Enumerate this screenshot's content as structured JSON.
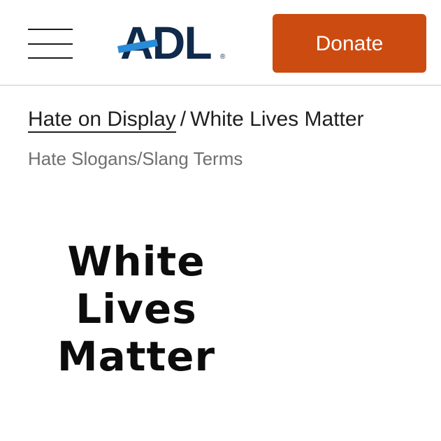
{
  "header": {
    "menu_icon": "hamburger-menu-icon",
    "logo": {
      "text": "ADL",
      "registered": "®",
      "colors": {
        "letters": "#0f2a4a",
        "stripe": "#2a8bd6"
      }
    },
    "donate_label": "Donate",
    "donate_color": "#cc4b10"
  },
  "breadcrumb": {
    "parent": "Hate on Display",
    "separator": "/",
    "current": "White Lives Matter"
  },
  "category": "Hate Slogans/Slang Terms",
  "image": {
    "lines": [
      "White",
      "Lives",
      "Matter"
    ]
  }
}
